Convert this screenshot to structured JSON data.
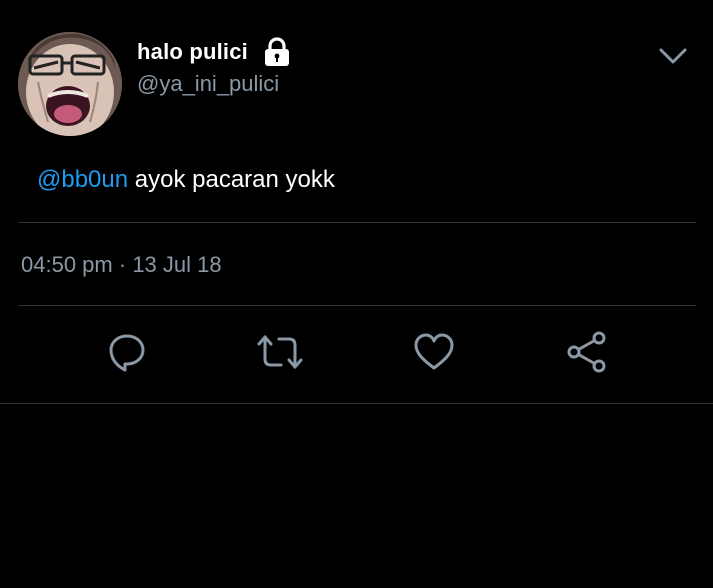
{
  "tweet": {
    "display_name": "halo pulici",
    "handle": "@ya_ini_pulici",
    "protected_icon": "lock-icon",
    "more_icon": "chevron-down-icon",
    "text": {
      "mention": "@bb0un",
      "body": " ayok pacaran yokk"
    },
    "time": "04:50 pm",
    "separator": "·",
    "date": "13 Jul 18",
    "actions": [
      {
        "name": "reply",
        "icon": "reply-bubble-icon"
      },
      {
        "name": "retweet",
        "icon": "retweet-icon"
      },
      {
        "name": "like",
        "icon": "heart-icon"
      },
      {
        "name": "share",
        "icon": "share-icon"
      }
    ]
  },
  "colors": {
    "background": "#000000",
    "text_primary": "#ffffff",
    "text_secondary": "#8b98a5",
    "accent": "#1d9bf0",
    "divider": "#2f3336"
  }
}
